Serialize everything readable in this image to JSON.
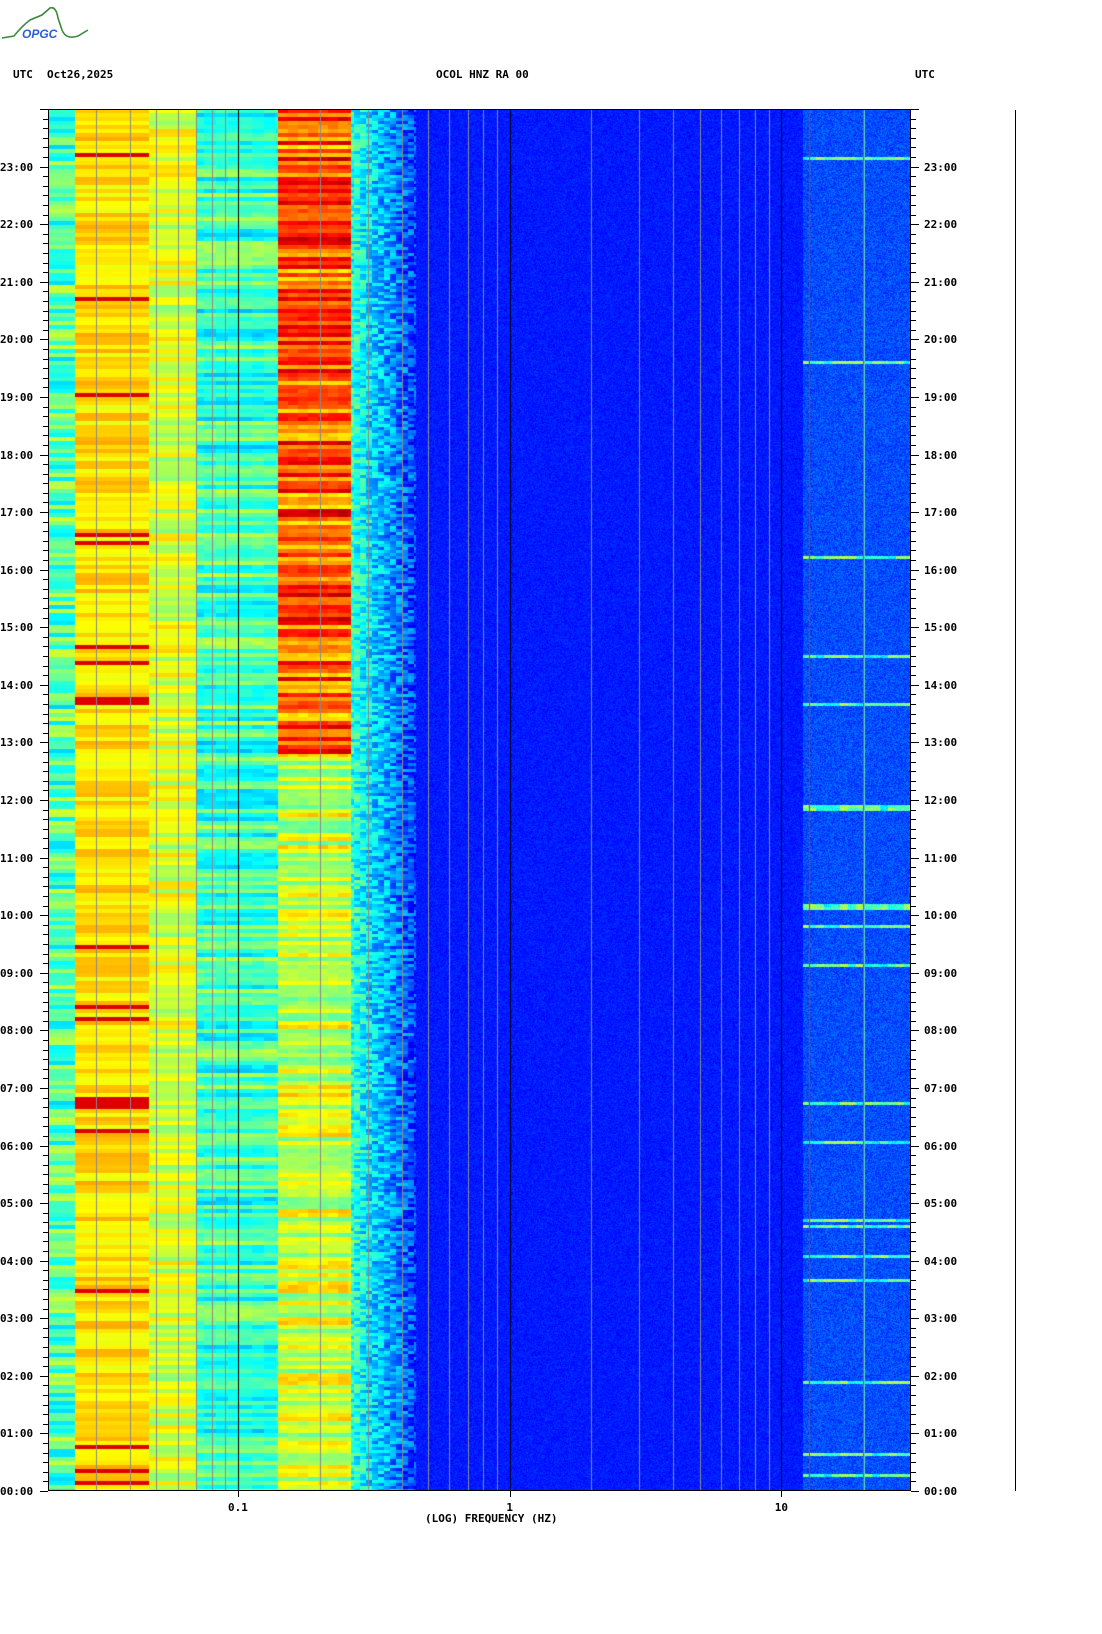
{
  "logo": {
    "text": "OPGC"
  },
  "header": {
    "left_timezone": "UTC",
    "date": "Oct26,2025",
    "station": "OCOL HNZ RA 00",
    "right_timezone": "UTC"
  },
  "chart_data": {
    "type": "heatmap",
    "title": "OCOL HNZ RA 00",
    "xlabel": "(LOG) FREQUENCY (HZ)",
    "ylabel": "UTC",
    "xscale": "log",
    "xlim": [
      0.02,
      30
    ],
    "xticks": [
      "0.1",
      "1",
      "10"
    ],
    "xtick_values": [
      0.1,
      1,
      10
    ],
    "ylim": [
      "00:00",
      "24:00"
    ],
    "yticks": [
      "00:00",
      "01:00",
      "02:00",
      "03:00",
      "04:00",
      "05:00",
      "06:00",
      "07:00",
      "08:00",
      "09:00",
      "10:00",
      "11:00",
      "12:00",
      "13:00",
      "14:00",
      "15:00",
      "16:00",
      "17:00",
      "18:00",
      "19:00",
      "20:00",
      "21:00",
      "22:00",
      "23:00"
    ],
    "colormap": "jet",
    "description_bands": [
      {
        "freq_range_hz": [
          0.025,
          0.047
        ],
        "level": "high"
      },
      {
        "freq_range_hz": [
          0.14,
          0.26
        ],
        "level": "high (13:00-24:00)"
      },
      {
        "freq_range_hz": [
          0.45,
          12
        ],
        "level": "low"
      },
      {
        "freq_range_hz": [
          12,
          30
        ],
        "level": "intermittent events"
      }
    ]
  }
}
